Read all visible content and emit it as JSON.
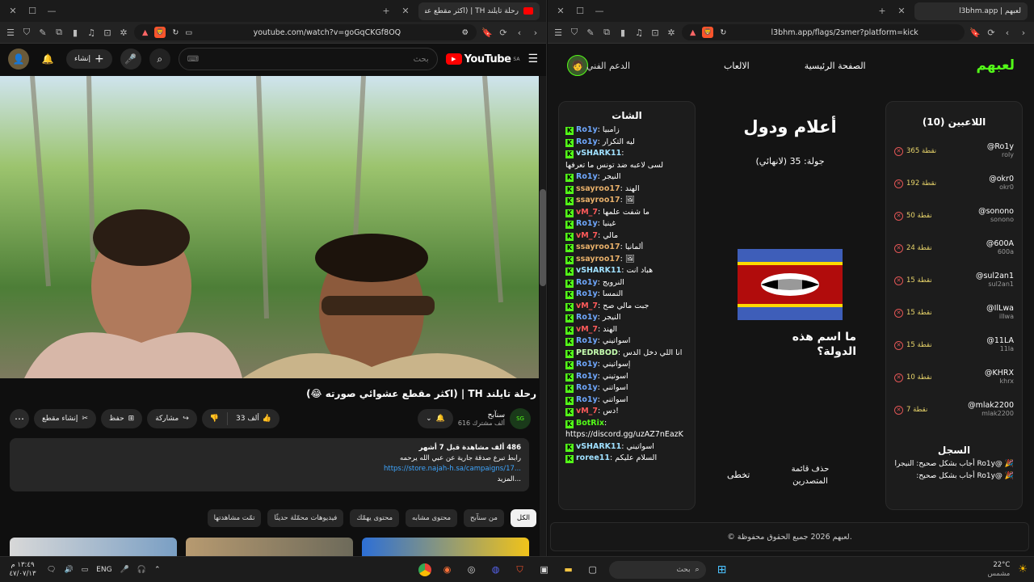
{
  "left": {
    "tab_title": "رحلة تايلند TH | (اكثر مقطع عشوائي صورته",
    "url": "youtube.com/watch?v=goGqCKGf8OQ",
    "shield_count": "38",
    "yt": {
      "logo": "YouTube",
      "region": "SA",
      "search_placeholder": "بحث",
      "create_label": "إنشاء"
    },
    "video": {
      "title": "رحلة تايلند TH | (اكثر مقطع عشوائي صورته 😂)",
      "channel": "سنآبح",
      "subs": "616 ألف مشترك",
      "likes": "33 ألف",
      "share_label": "مشاركة",
      "save_label": "حفظ",
      "clip_label": "إنشاء مقطع",
      "desc_stats": "486 ألف مشاهدة  قبل 7 أشهر",
      "desc_line": "رابط تبرع صدقة جارية عن عبي الله يرحمه",
      "desc_link": "https://store.najah-h.sa/campaigns/17...",
      "desc_more": "...المزيد"
    },
    "chips": [
      "الكل",
      "من سنآبح",
      "محتوى مشابه",
      "محتوى يهمّك",
      "فيديوهات محمّلة حديثًا",
      "تمّت مشاهدتها"
    ]
  },
  "right": {
    "tab_title": "l3bhm.app | لعبهم",
    "url": "l3bhm.app/flags/2smer?platform=kick",
    "nav": {
      "brand": "لعبهم",
      "home": "الصفحة الرئيسية",
      "games": "الالعاب",
      "support": "الدعم الفني"
    },
    "chat": {
      "title": "الشات",
      "lines": [
        {
          "user": "Ro1y",
          "color": "#6fa8ff",
          "msg": "زامبيا"
        },
        {
          "user": "Ro1y",
          "color": "#6fa8ff",
          "msg": "ليه التكرار"
        },
        {
          "user": "vSHARK11",
          "color": "#9fe0ff",
          "msg": ""
        },
        {
          "user": "",
          "color": "#fff",
          "msg": "لسى لاعبه ضد تونس ما تعرفها"
        },
        {
          "user": "Ro1y",
          "color": "#6fa8ff",
          "msg": "النيجر"
        },
        {
          "user": "ssayroo17",
          "color": "#e8b06a",
          "msg": "الهند"
        },
        {
          "user": "ssayroo17",
          "color": "#e8b06a",
          "msg": "🖼"
        },
        {
          "user": "vM_7",
          "color": "#ff5a5a",
          "msg": "ما شفت علمها"
        },
        {
          "user": "Ro1y",
          "color": "#6fa8ff",
          "msg": "غينيا"
        },
        {
          "user": "vM_7",
          "color": "#ff5a5a",
          "msg": "مالي"
        },
        {
          "user": "ssayroo17",
          "color": "#e8b06a",
          "msg": "ألمانيا"
        },
        {
          "user": "ssayroo17",
          "color": "#e8b06a",
          "msg": "🖼"
        },
        {
          "user": "vSHARK11",
          "color": "#9fe0ff",
          "msg": "هباد انت"
        },
        {
          "user": "Ro1y",
          "color": "#6fa8ff",
          "msg": "النرويج"
        },
        {
          "user": "Ro1y",
          "color": "#6fa8ff",
          "msg": "النمسا"
        },
        {
          "user": "vM_7",
          "color": "#ff5a5a",
          "msg": "جبت مالي صح"
        },
        {
          "user": "Ro1y",
          "color": "#6fa8ff",
          "msg": "النيجر"
        },
        {
          "user": "vM_7",
          "color": "#ff5a5a",
          "msg": "الهند"
        },
        {
          "user": "Ro1y",
          "color": "#6fa8ff",
          "msg": "اسواتيني"
        },
        {
          "user": "PEDRBOD",
          "color": "#c6ffb0",
          "msg": "انا اللي دخل الدس"
        },
        {
          "user": "Ro1y",
          "color": "#6fa8ff",
          "msg": "إسواتيني"
        },
        {
          "user": "Ro1y",
          "color": "#6fa8ff",
          "msg": "اسوتيني"
        },
        {
          "user": "Ro1y",
          "color": "#6fa8ff",
          "msg": "اسواتني"
        },
        {
          "user": "Ro1y",
          "color": "#6fa8ff",
          "msg": "اسواتني"
        },
        {
          "user": "vM_7",
          "color": "#ff5a5a",
          "msg": "دس!"
        },
        {
          "user": "BotRix",
          "color": "#53fc18",
          "msg": ""
        },
        {
          "user": "",
          "color": "#fff",
          "msg": "https://discord.gg/uzAZ7nEazK"
        },
        {
          "user": "vSHARK11",
          "color": "#9fe0ff",
          "msg": "اسواتيني"
        },
        {
          "user": "roree11",
          "color": "#9fe0ff",
          "msg": "السلام عليكم"
        }
      ]
    },
    "game": {
      "title": "أعلام ودول",
      "round": "جولة: 35 (لانهائي)",
      "question": "ما اسم هذه الدولة؟",
      "skip": "تخطى",
      "delete_leaders": "حذف قائمة المتصدرين"
    },
    "players": {
      "title": "اللاعبين (10)",
      "list": [
        {
          "name": "@Ro1y",
          "handle": "roly",
          "points": "365 نقطة"
        },
        {
          "name": "@okr0",
          "handle": "okr0",
          "points": "192 نقطة"
        },
        {
          "name": "@sonono",
          "handle": "sonono",
          "points": "50 نقطة"
        },
        {
          "name": "@600A",
          "handle": "600a",
          "points": "24 نقطة"
        },
        {
          "name": "@sul2an1",
          "handle": "sul2an1",
          "points": "15 نقطة"
        },
        {
          "name": "@IlLwa",
          "handle": "illwa",
          "points": "15 نقطة"
        },
        {
          "name": "@11LA",
          "handle": "11la",
          "points": "15 نقطة"
        },
        {
          "name": "@KHRX",
          "handle": "khrx",
          "points": "10 نقطة"
        },
        {
          "name": "@mlak2200",
          "handle": "mlak2200",
          "points": "7 نقطة"
        }
      ]
    },
    "log": {
      "title": "السجل",
      "entries": [
        "🎉 @Ro1y أجاب بشكل صحيح: النيجرا",
        "🎉 @Ro1y أجاب بشكل صحيح:"
      ]
    },
    "footer": "© لعبهم 2026 جميع الحقوق محفوظة."
  },
  "taskbar": {
    "weather": "22°C",
    "weather_desc": "مشمس",
    "search": "بحث",
    "lang": "ENG",
    "time": "١٣:٤٩ م",
    "date": "٤٧/٠٧/١٣"
  },
  "colors": {
    "accent_green": "#53fc18",
    "youtube_red": "#ff0000",
    "flag_blue": "#3e5eb9",
    "flag_red": "#b10c0c",
    "flag_yellow": "#ffd900"
  }
}
